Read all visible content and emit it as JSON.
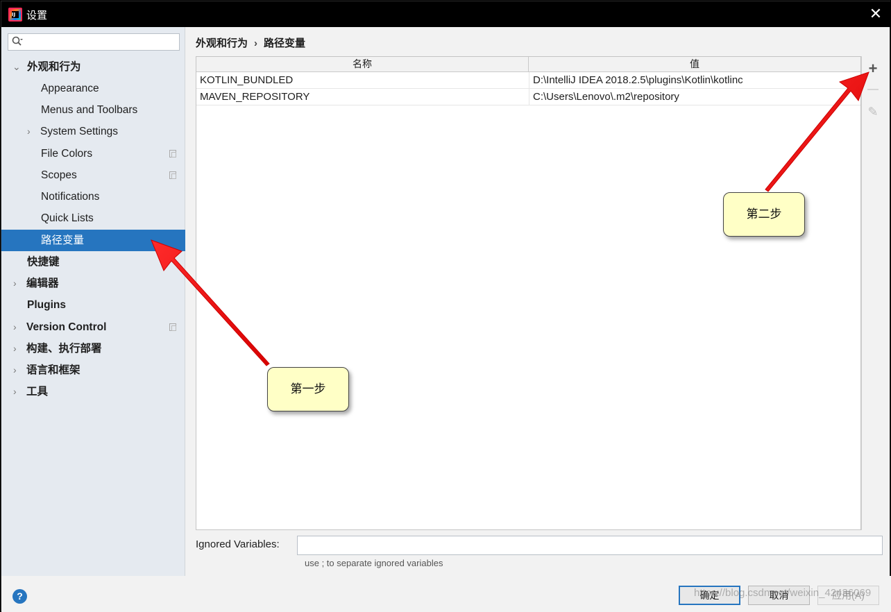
{
  "window": {
    "title": "设置",
    "close_glyph": "✕"
  },
  "sidebar": {
    "search_placeholder": "",
    "items": [
      {
        "label": "外观和行为",
        "expanded": true,
        "bold": true
      },
      {
        "label": "Appearance"
      },
      {
        "label": "Menus and Toolbars"
      },
      {
        "label": "System Settings",
        "collapsed": true
      },
      {
        "label": "File Colors",
        "copy_icon": true
      },
      {
        "label": "Scopes",
        "copy_icon": true
      },
      {
        "label": "Notifications"
      },
      {
        "label": "Quick Lists"
      },
      {
        "label": "路径变量",
        "selected": true
      },
      {
        "label": "快捷键",
        "bold": true
      },
      {
        "label": "编辑器",
        "bold": true,
        "collapsed": true
      },
      {
        "label": "Plugins",
        "bold": true
      },
      {
        "label": "Version Control",
        "bold": true,
        "collapsed": true,
        "copy_icon": true
      },
      {
        "label": "构建、执行部署",
        "bold": true,
        "collapsed": true
      },
      {
        "label": "语言和框架",
        "bold": true,
        "collapsed": true
      },
      {
        "label": "工具",
        "bold": true,
        "collapsed": true
      }
    ],
    "selected_color": "#2675bf"
  },
  "breadcrumb": {
    "parent": "外观和行为",
    "separator": "›",
    "current": "路径变量"
  },
  "table": {
    "headers": {
      "name": "名称",
      "value": "值"
    },
    "rows": [
      {
        "name": "KOTLIN_BUNDLED",
        "value": "D:\\IntelliJ IDEA 2018.2.5\\plugins\\Kotlin\\kotlinc"
      },
      {
        "name": "MAVEN_REPOSITORY",
        "value": "C:\\Users\\Lenovo\\.m2\\repository"
      }
    ]
  },
  "tools": {
    "add": "+",
    "remove": "—",
    "edit": "✎"
  },
  "ignored": {
    "label": "Ignored Variables:",
    "value": "",
    "hint": "use ; to separate ignored variables"
  },
  "buttons": {
    "help": "?",
    "ok": "确定",
    "cancel": "取消",
    "apply": "应用(A)"
  },
  "annotations": {
    "step1": "第一步",
    "step2": "第二步",
    "arrow_color": "#ff1a1a"
  },
  "watermark": "https://blog.csdn.net/weixin_42436069"
}
